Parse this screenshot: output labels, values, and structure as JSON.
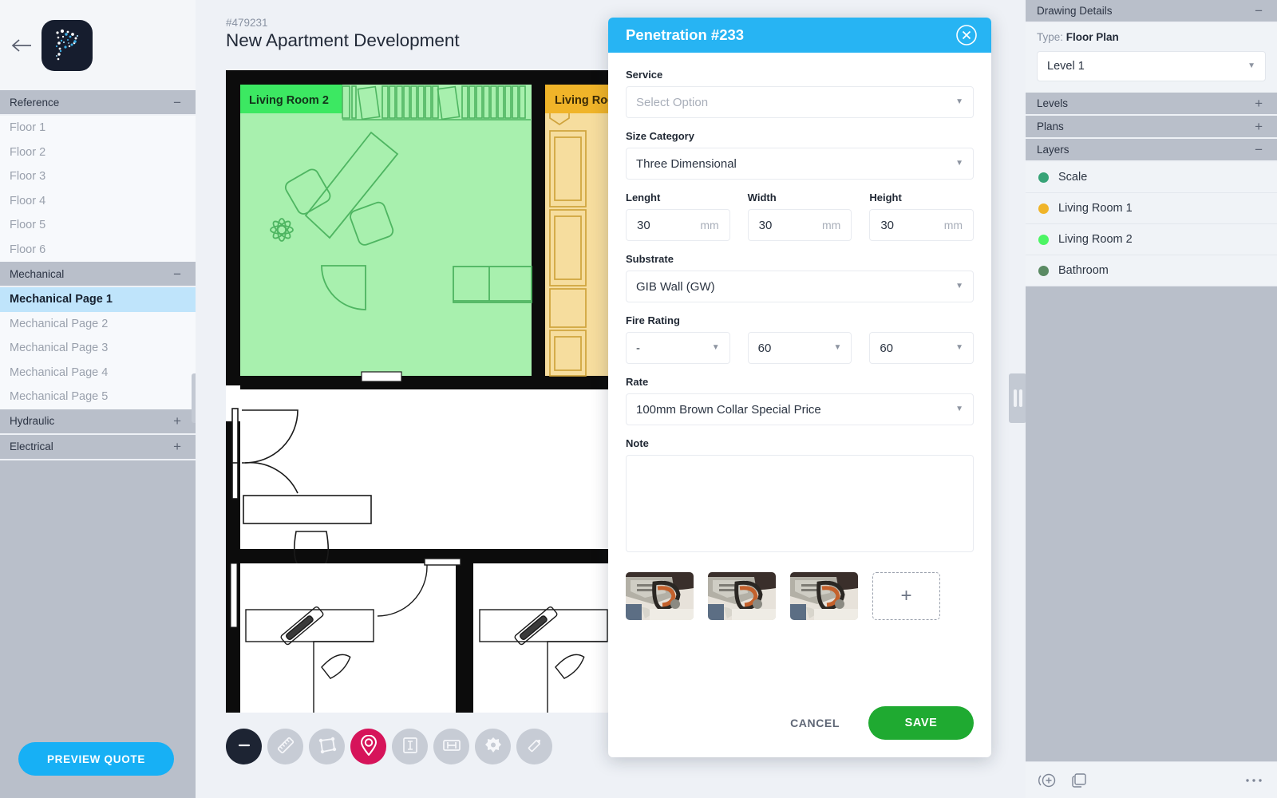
{
  "sidebar": {
    "back_icon": "arrow-left-icon",
    "logo_alt": "P",
    "sections": [
      {
        "title": "Reference",
        "toggle": "−",
        "items": [
          {
            "label": "Floor 1",
            "active": false
          },
          {
            "label": "Floor 2",
            "active": false
          },
          {
            "label": "Floor 3",
            "active": false
          },
          {
            "label": "Floor 4",
            "active": false
          },
          {
            "label": "Floor 5",
            "active": false
          },
          {
            "label": "Floor 6",
            "active": false
          }
        ]
      },
      {
        "title": "Mechanical",
        "toggle": "−",
        "items": [
          {
            "label": "Mechanical Page 1",
            "active": true
          },
          {
            "label": "Mechanical Page 2",
            "active": false
          },
          {
            "label": "Mechanical Page 3",
            "active": false
          },
          {
            "label": "Mechanical Page 4",
            "active": false
          },
          {
            "label": "Mechanical Page 5",
            "active": false
          }
        ]
      },
      {
        "title": "Hydraulic",
        "toggle": "+",
        "items": []
      },
      {
        "title": "Electrical",
        "toggle": "+",
        "items": []
      }
    ],
    "preview_quote_label": "PREVIEW QUOTE"
  },
  "document": {
    "reference": "#479231",
    "title": "New Apartment Development"
  },
  "plan": {
    "rooms": [
      {
        "name": "Living Room 2",
        "label_bg": "#3ce862",
        "fill": "#a8f0ae"
      },
      {
        "name": "Living Room 1",
        "label_bg": "#f0b429",
        "fill": "#f6dd9e"
      }
    ],
    "marker": {
      "id": "233",
      "color": "#d6145a"
    }
  },
  "toolbar": {
    "tools": [
      {
        "name": "collapse-toolbar-button",
        "icon": "minus-icon",
        "state": "dark"
      },
      {
        "name": "scale-tool-button",
        "icon": "ruler-icon",
        "state": "normal"
      },
      {
        "name": "area-tool-button",
        "icon": "polygon-icon",
        "state": "normal"
      },
      {
        "name": "pin-tool-button",
        "icon": "map-pin-icon",
        "state": "active"
      },
      {
        "name": "text-tool-button",
        "icon": "text-icon",
        "state": "normal"
      },
      {
        "name": "linear-tool-button",
        "icon": "linear-measure-icon",
        "state": "normal"
      },
      {
        "name": "shape-tool-button",
        "icon": "burst-icon",
        "state": "normal"
      },
      {
        "name": "draw-tool-button",
        "icon": "pencil-icon",
        "state": "normal"
      }
    ]
  },
  "modal": {
    "title": "Penetration #233",
    "close_icon": "close-circle-icon",
    "fields": {
      "service": {
        "label": "Service",
        "value": "",
        "placeholder": "Select Option"
      },
      "size_category": {
        "label": "Size Category",
        "value": "Three Dimensional"
      },
      "length": {
        "label": "Lenght",
        "value": "30",
        "unit": "mm"
      },
      "width": {
        "label": "Width",
        "value": "30",
        "unit": "mm"
      },
      "height": {
        "label": "Height",
        "value": "30",
        "unit": "mm"
      },
      "substrate": {
        "label": "Substrate",
        "value": "GIB Wall (GW)"
      },
      "fire_rating": {
        "label": "Fire Rating",
        "values": [
          "-",
          "60",
          "60"
        ]
      },
      "rate": {
        "label": "Rate",
        "value": "100mm Brown Collar Special Price"
      },
      "note": {
        "label": "Note",
        "value": "",
        "placeholder": ""
      }
    },
    "attachments": {
      "count": 3,
      "add_label": "+"
    },
    "cancel_label": "CANCEL",
    "save_label": "SAVE",
    "save_color": "#1faa31",
    "header_color": "#27b4f3"
  },
  "right_panel": {
    "sections": [
      {
        "title": "Drawing Details",
        "toggle": "−"
      },
      {
        "title": "Levels",
        "toggle": "+"
      },
      {
        "title": "Plans",
        "toggle": "+"
      },
      {
        "title": "Layers",
        "toggle": "−"
      }
    ],
    "type_label": "Type:",
    "type_value": "Floor Plan",
    "level_value": "Level 1",
    "layers": [
      {
        "label": "Scale",
        "color": "#37a377"
      },
      {
        "label": "Living Room 1",
        "color": "#f0b429"
      },
      {
        "label": "Living Room 2",
        "color": "#4cf564"
      },
      {
        "label": "Bathroom",
        "color": "#5a8a63"
      }
    ],
    "footer_icons": [
      {
        "name": "add-layer-icon"
      },
      {
        "name": "duplicate-icon"
      },
      {
        "name": "more-options-icon"
      }
    ]
  }
}
